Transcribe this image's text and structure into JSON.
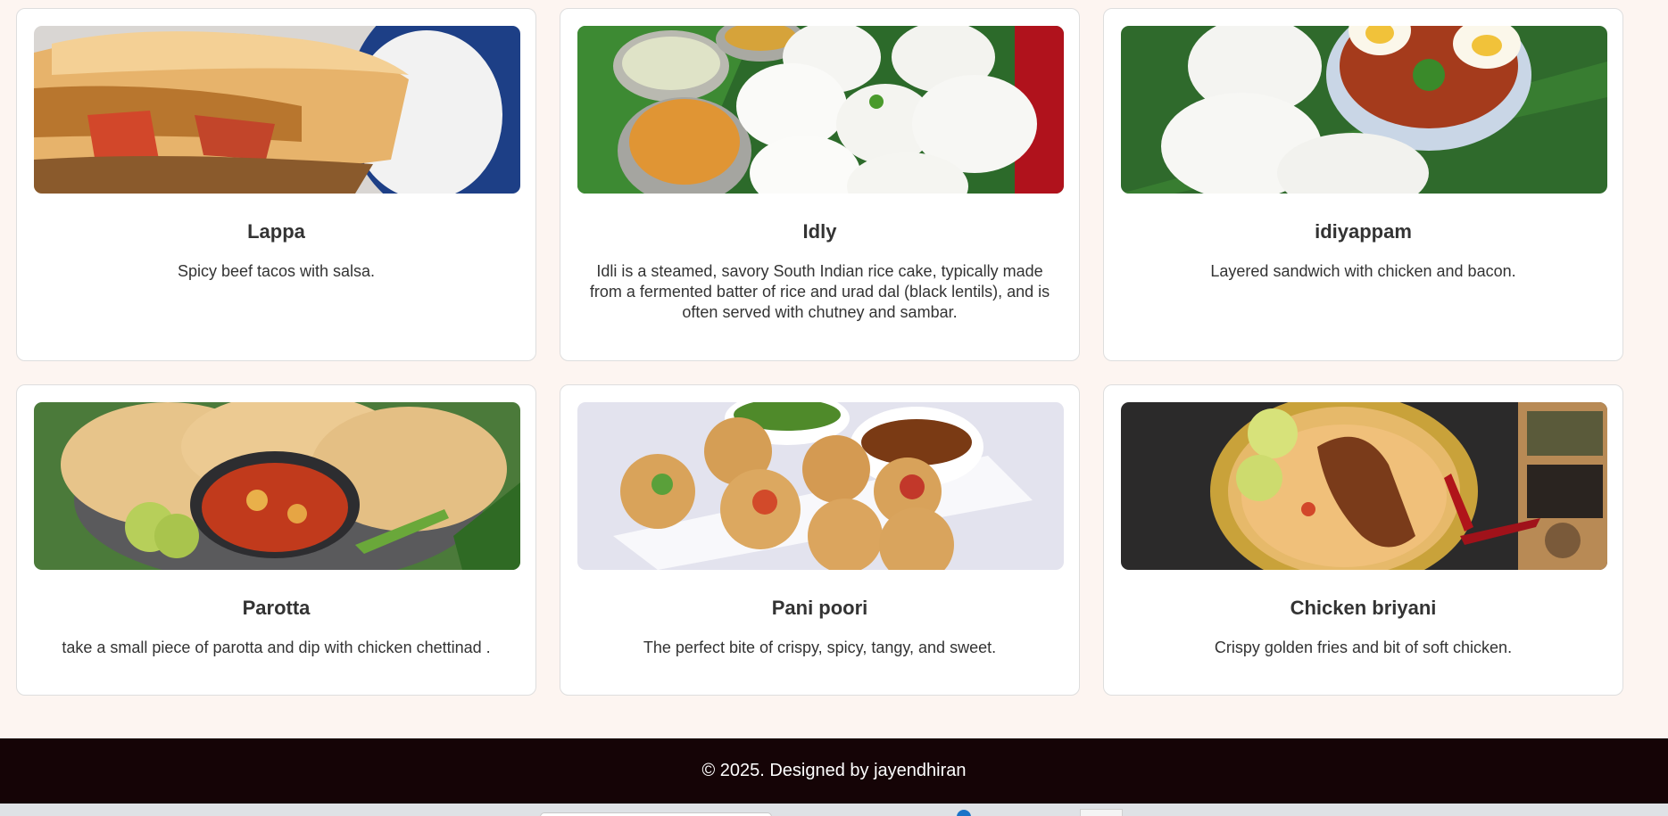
{
  "cards": [
    {
      "title": "Lappa",
      "description": "Spicy beef tacos with salsa.",
      "image": "lasagna-photo"
    },
    {
      "title": "Idly",
      "description": "Idli is a steamed, savory South Indian rice cake, typically made from a fermented batter of rice and urad dal (black lentils), and is often served with chutney and sambar.",
      "image": "idli-photo"
    },
    {
      "title": "idiyappam",
      "description": "Layered sandwich with chicken and bacon.",
      "image": "idiyappam-photo"
    },
    {
      "title": "Parotta",
      "description": "take a small piece of parotta and dip with chicken chettinad .",
      "image": "parotta-photo"
    },
    {
      "title": "Pani poori",
      "description": "The perfect bite of crispy, spicy, tangy, and sweet.",
      "image": "pani-poori-photo"
    },
    {
      "title": "Chicken briyani",
      "description": "Crispy golden fries and bit of soft chicken.",
      "image": "chicken-briyani-photo"
    }
  ],
  "footer": {
    "text": "© 2025. Designed by jayendhiran"
  },
  "colors": {
    "page_bg": "#fdf5f1",
    "card_bg": "#ffffff",
    "footer_bg": "#150406",
    "text": "#333333"
  }
}
